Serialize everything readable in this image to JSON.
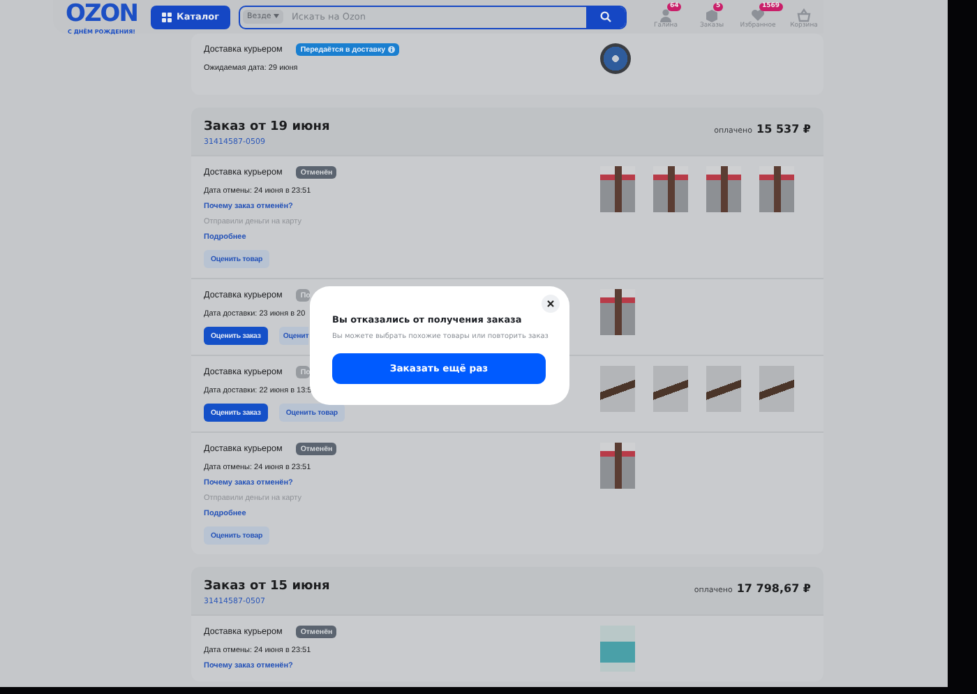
{
  "header": {
    "logo": "OZON",
    "logo_tagline": "С ДНЁМ РОЖДЕНИЯ!",
    "catalog_button": "Каталог",
    "search": {
      "scope": "Везде",
      "placeholder": "Искать на Ozon"
    },
    "nav": [
      {
        "kind": "user",
        "label": "Галина",
        "badge": "64"
      },
      {
        "kind": "orders",
        "label": "Заказы",
        "badge": "5"
      },
      {
        "kind": "favorites",
        "label": "Избранное",
        "badge": "1569"
      },
      {
        "kind": "cart",
        "label": "Корзина"
      }
    ]
  },
  "orders": [
    {
      "shipments": [
        {
          "method": "Доставка курьером",
          "status": {
            "kind": "info",
            "text": "Передаётся в доставку"
          },
          "lines": [
            {
              "kind": "date",
              "text": "Ожидаемая дата: 29 июня"
            }
          ],
          "products": [
            {
              "kind": "disc"
            }
          ]
        }
      ]
    },
    {
      "title": "Заказ от 19 июня",
      "number": "31414587-0509",
      "paid_label": "оплачено",
      "amount": "15 537 ₽",
      "shipments": [
        {
          "method": "Доставка курьером",
          "status": {
            "kind": "cancelled",
            "text": "Отменён"
          },
          "lines": [
            {
              "kind": "date",
              "text": "Дата отмены: 24 июня в 23:51"
            },
            {
              "kind": "link",
              "text": "Почему заказ отменён?"
            },
            {
              "kind": "muted",
              "text": "Отправили деньги на карту"
            },
            {
              "kind": "link",
              "text": "Подробнее"
            }
          ],
          "buttons": [
            {
              "kind": "secondary",
              "text": "Оценить товар"
            }
          ],
          "products": [
            {
              "kind": "deck"
            },
            {
              "kind": "deck"
            },
            {
              "kind": "deck"
            },
            {
              "kind": "deck"
            }
          ]
        },
        {
          "method": "Доставка курьером",
          "status": {
            "kind": "neutral",
            "text": "По"
          },
          "lines": [
            {
              "kind": "date",
              "text": "Дата доставки: 23 июня в 20"
            }
          ],
          "buttons": [
            {
              "kind": "primary",
              "text": "Оценить заказ"
            },
            {
              "kind": "secondary",
              "text": "Оценит",
              "clipped": true
            }
          ],
          "products": [
            {
              "kind": "deck"
            }
          ]
        },
        {
          "method": "Доставка курьером",
          "status": {
            "kind": "neutral",
            "text": "По"
          },
          "lines": [
            {
              "kind": "date",
              "text": "Дата доставки: 22 июня в 13:5"
            }
          ],
          "buttons": [
            {
              "kind": "primary",
              "text": "Оценить заказ"
            },
            {
              "kind": "secondary",
              "text": "Оценить товар"
            }
          ],
          "products": [
            {
              "kind": "corner"
            },
            {
              "kind": "corner"
            },
            {
              "kind": "corner"
            },
            {
              "kind": "corner"
            }
          ]
        },
        {
          "method": "Доставка курьером",
          "status": {
            "kind": "cancelled",
            "text": "Отменён"
          },
          "lines": [
            {
              "kind": "date",
              "text": "Дата отмены: 24 июня в 23:51"
            },
            {
              "kind": "link",
              "text": "Почему заказ отменён?"
            },
            {
              "kind": "muted",
              "text": "Отправили деньги на карту"
            },
            {
              "kind": "link",
              "text": "Подробнее"
            }
          ],
          "buttons": [
            {
              "kind": "secondary",
              "text": "Оценить товар"
            }
          ],
          "products": [
            {
              "kind": "deck"
            }
          ]
        }
      ]
    },
    {
      "title": "Заказ от 15 июня",
      "number": "31414587-0507",
      "paid_label": "оплачено",
      "amount": "17 798,67 ₽",
      "shipments": [
        {
          "method": "Доставка курьером",
          "status": {
            "kind": "cancelled",
            "text": "Отменён"
          },
          "lines": [
            {
              "kind": "date",
              "text": "Дата отмены: 24 июня в 23:51"
            },
            {
              "kind": "link",
              "text": "Почему заказ отменён?"
            }
          ],
          "products": [
            {
              "kind": "canister"
            }
          ]
        }
      ]
    }
  ],
  "modal": {
    "title": "Вы отказались от получения заказа",
    "text": "Вы можете выбрать похожие товары или повторить заказ",
    "button": "Заказать ещё раз"
  }
}
